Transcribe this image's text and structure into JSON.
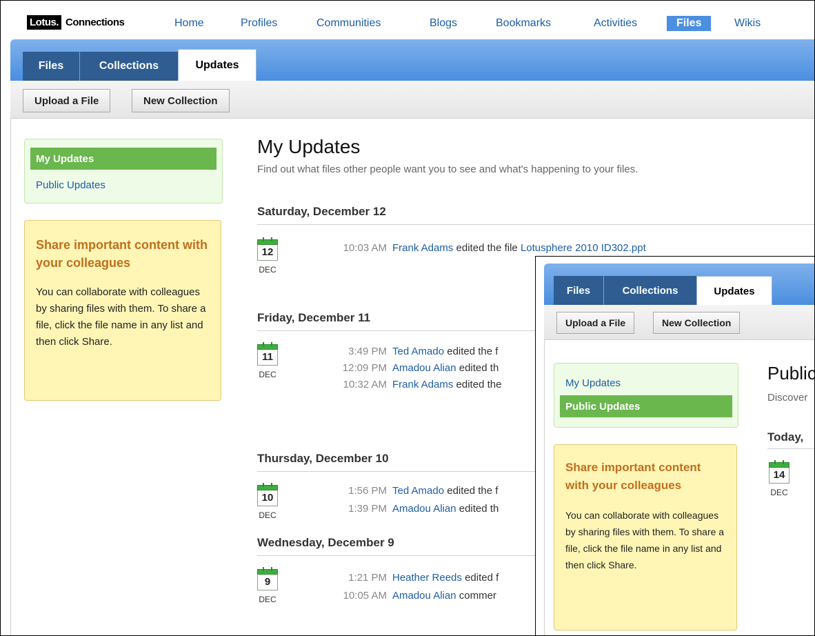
{
  "brand": {
    "logo_box": "Lotus.",
    "logo_text": "Connections"
  },
  "nav": [
    "Home",
    "Profiles",
    "Communities",
    "Blogs",
    "Bookmarks",
    "Activities",
    "Files",
    "Wikis"
  ],
  "tabs": [
    "Files",
    "Collections",
    "Updates"
  ],
  "toolbar": {
    "upload": "Upload a File",
    "new_collection": "New Collection"
  },
  "sidebar": {
    "my_updates": "My Updates",
    "public_updates": "Public Updates"
  },
  "share": {
    "title": "Share important content with your colleagues",
    "text": "You can collaborate with colleagues by sharing files with them. To share a file, click the file name in any list and then click Share."
  },
  "main": {
    "title": "My Updates",
    "subtitle": "Find out what files other people want you to see and what's happening to your files."
  },
  "days": [
    {
      "heading": "Saturday, December 12",
      "date": "12",
      "month": "DEC",
      "items": [
        {
          "time": "10:03 AM",
          "user": "Frank Adams",
          "action": " edited the file ",
          "file": "Lotusphere 2010 ID302.ppt"
        }
      ]
    },
    {
      "heading": "Friday, December 11",
      "date": "11",
      "month": "DEC",
      "items": [
        {
          "time": "3:49 PM",
          "user": "Ted Amado",
          "action": " edited the f",
          "file": ""
        },
        {
          "time": "12:09 PM",
          "user": "Amadou Alian",
          "action": " edited th",
          "file": ""
        },
        {
          "time": "10:32 AM",
          "user": "Frank Adams",
          "action": " edited the",
          "file": ""
        }
      ]
    },
    {
      "heading": "Thursday, December 10",
      "date": "10",
      "month": "DEC",
      "items": [
        {
          "time": "1:56 PM",
          "user": "Ted Amado",
          "action": " edited the f",
          "file": ""
        },
        {
          "time": "1:39 PM",
          "user": "Amadou Alian",
          "action": " edited th",
          "file": ""
        }
      ]
    },
    {
      "heading": "Wednesday, December 9",
      "date": "9",
      "month": "DEC",
      "items": [
        {
          "time": "1:21 PM",
          "user": "Heather Reeds",
          "action": " edited f",
          "file": ""
        },
        {
          "time": "10:05 AM",
          "user": "Amadou Alian",
          "action": " commer",
          "file": ""
        }
      ]
    }
  ],
  "inset": {
    "title": "Public",
    "subtitle": "Discover",
    "day_heading": "Today,",
    "date": "14",
    "month": "DEC"
  },
  "colors": {
    "link": "#1d5ea8",
    "nav_active": "#4a8fe0",
    "tab_dark": "#2f5d92",
    "green_active": "#6ab74e",
    "share_title": "#c16e1e"
  }
}
